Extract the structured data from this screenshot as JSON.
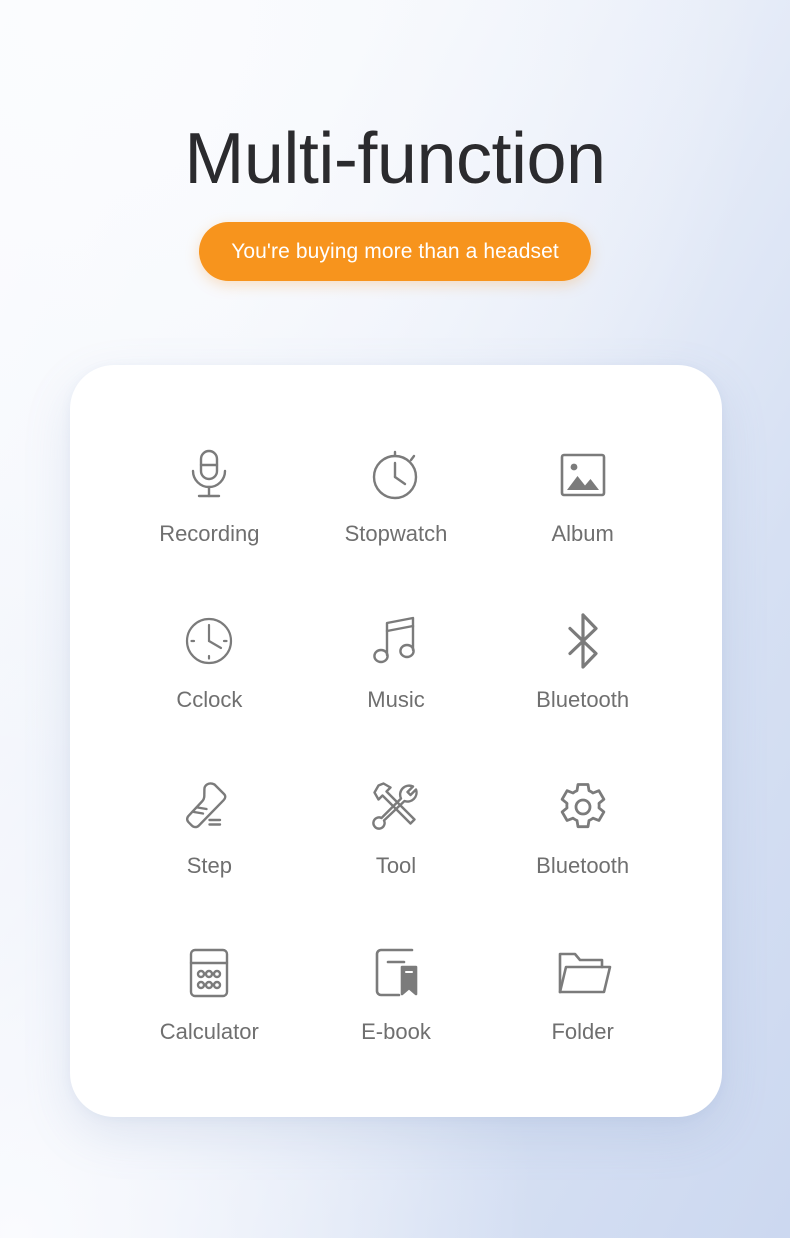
{
  "header": {
    "title": "Multi-function",
    "badge_label": "You're buying more than a headset"
  },
  "colors": {
    "accent_orange": "#F7941D",
    "title_text": "#2B2B2E",
    "label_text": "#6F6F6F",
    "icon_stroke": "#7B7B7B",
    "card_background": "#FFFFFF",
    "page_background_start": "#F9FAFD",
    "page_background_end": "#CCD8F0"
  },
  "card": {
    "features": [
      {
        "label": "Recording",
        "icon": "microphone-icon"
      },
      {
        "label": "Stopwatch",
        "icon": "stopwatch-icon"
      },
      {
        "label": "Album",
        "icon": "photo-icon"
      },
      {
        "label": "Cclock",
        "icon": "clock-icon"
      },
      {
        "label": "Music",
        "icon": "music-note-icon"
      },
      {
        "label": "Bluetooth",
        "icon": "bluetooth-icon"
      },
      {
        "label": "Step",
        "icon": "shoe-icon"
      },
      {
        "label": "Tool",
        "icon": "tools-icon"
      },
      {
        "label": "Bluetooth",
        "icon": "gear-icon"
      },
      {
        "label": "Calculator",
        "icon": "calculator-icon"
      },
      {
        "label": "E-book",
        "icon": "book-bookmark-icon"
      },
      {
        "label": "Folder",
        "icon": "folder-icon"
      }
    ]
  }
}
